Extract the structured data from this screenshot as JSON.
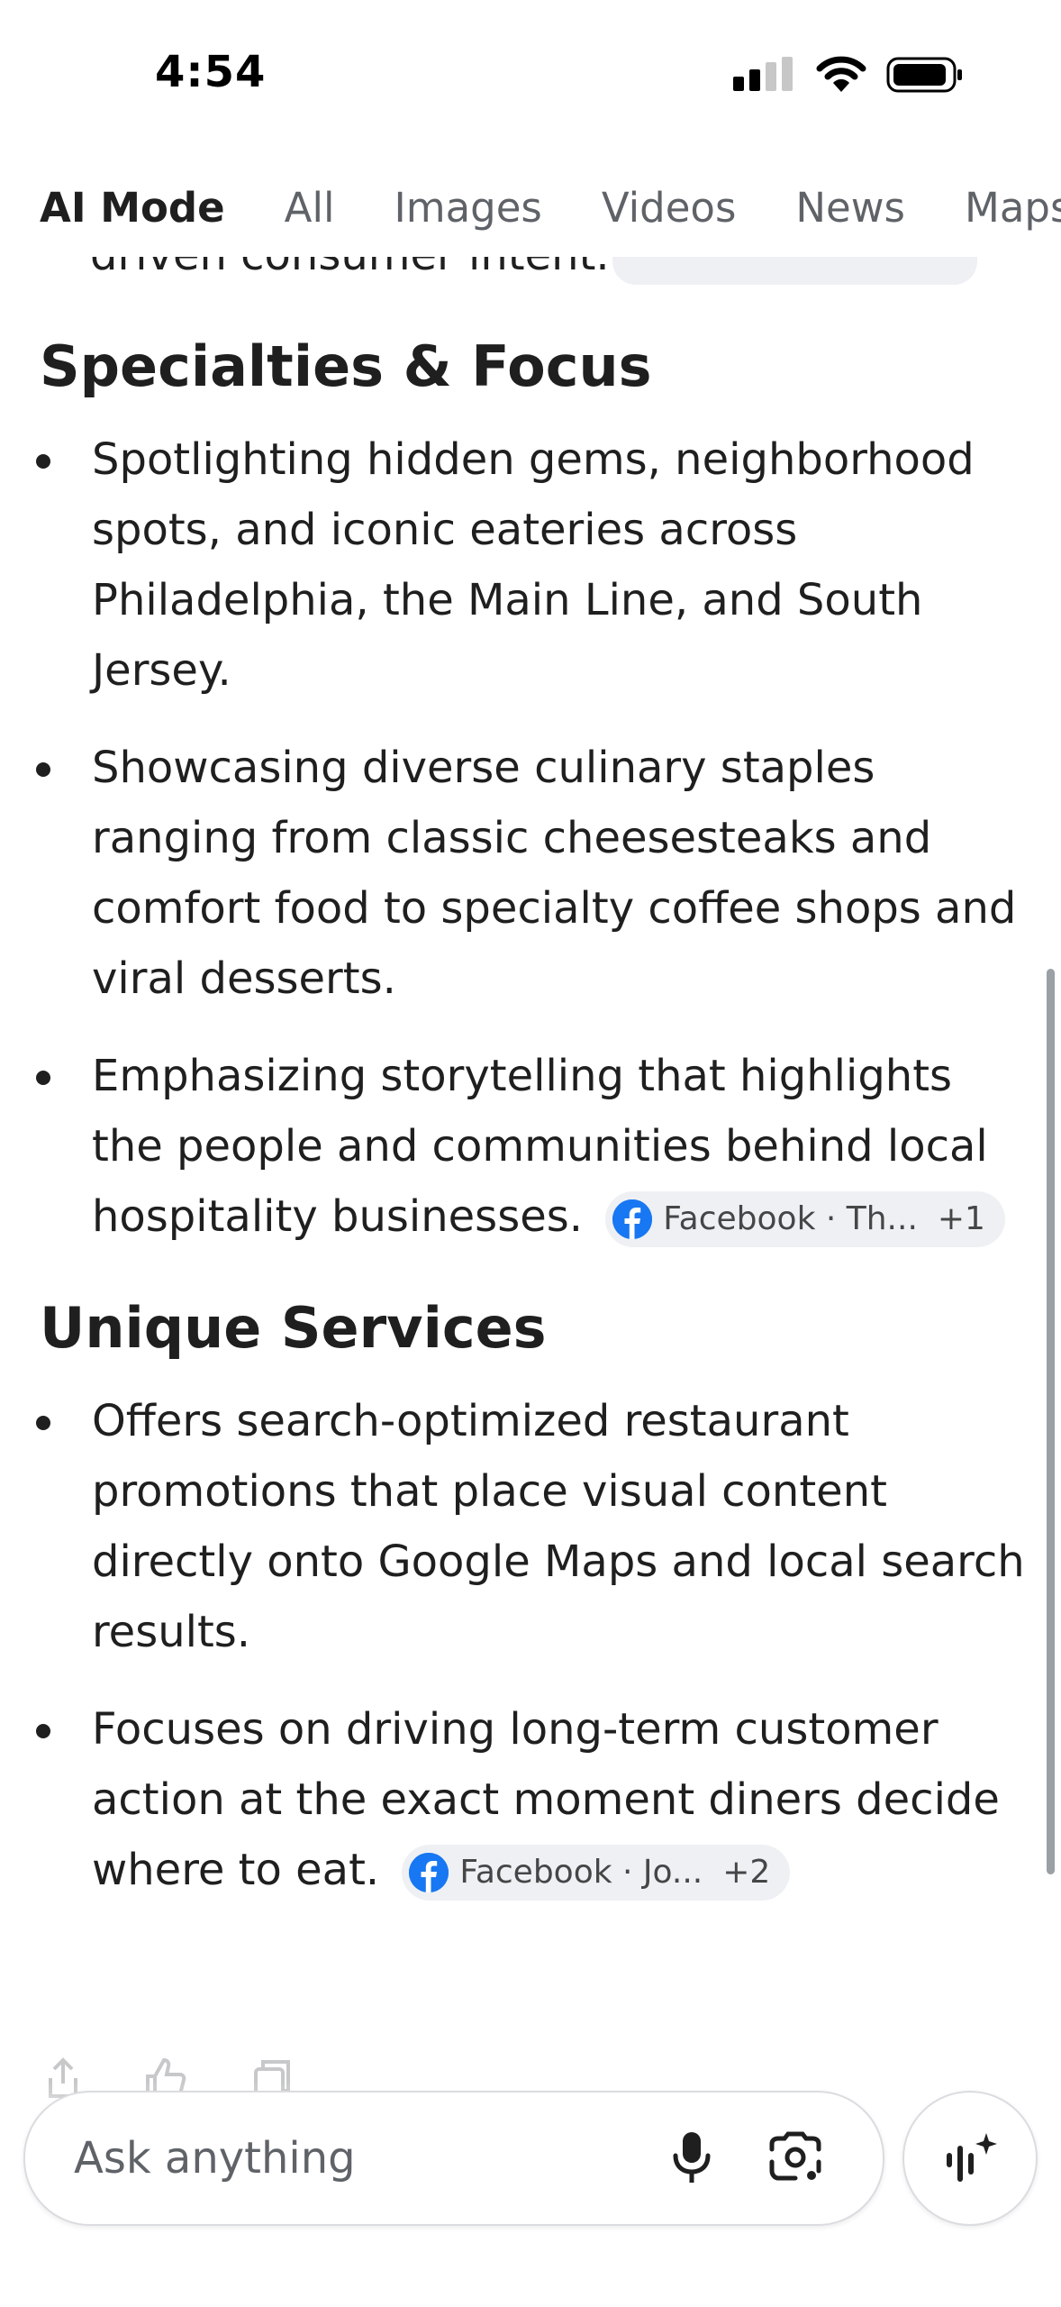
{
  "status_bar": {
    "time": "4:54"
  },
  "tabs": [
    {
      "label": "AI Mode",
      "active": true
    },
    {
      "label": "All"
    },
    {
      "label": "Images"
    },
    {
      "label": "Videos"
    },
    {
      "label": "News"
    },
    {
      "label": "Maps"
    }
  ],
  "scroll_peek": {
    "text": "driven consumer intent."
  },
  "sections": [
    {
      "heading": "Specialties & Focus",
      "bullets": [
        {
          "text": "Spotlighting hidden gems, neighborhood spots, and iconic eateries across Philadelphia, the Main Line, and South Jersey."
        },
        {
          "text": "Showcasing diverse culinary staples ranging from classic cheesesteaks and comfort food to specialty coffee shops and viral desserts."
        },
        {
          "text": "Emphasizing storytelling that highlights the people and communities behind local hospitality businesses.",
          "chip": {
            "label": "Facebook · Th...",
            "count": "+1"
          }
        }
      ]
    },
    {
      "heading": "Unique Services",
      "bullets": [
        {
          "text": "Offers search-optimized restaurant promotions that place visual content directly onto Google Maps and local search results."
        },
        {
          "text": "Focuses on driving long-term customer action at the exact moment diners decide where to eat.",
          "chip": {
            "label": "Facebook · Jo...",
            "count": "+2"
          }
        }
      ]
    }
  ],
  "search": {
    "placeholder": "Ask anything"
  },
  "icons": {
    "mic": "mic-icon",
    "lens": "lens-camera-icon",
    "voice": "voice-sparkle-icon",
    "facebook": "facebook-icon"
  },
  "colors": {
    "text": "#1f1f1f",
    "muted": "#5f6368",
    "chip_bg": "#eef0f4",
    "facebook": "#1877f2"
  }
}
